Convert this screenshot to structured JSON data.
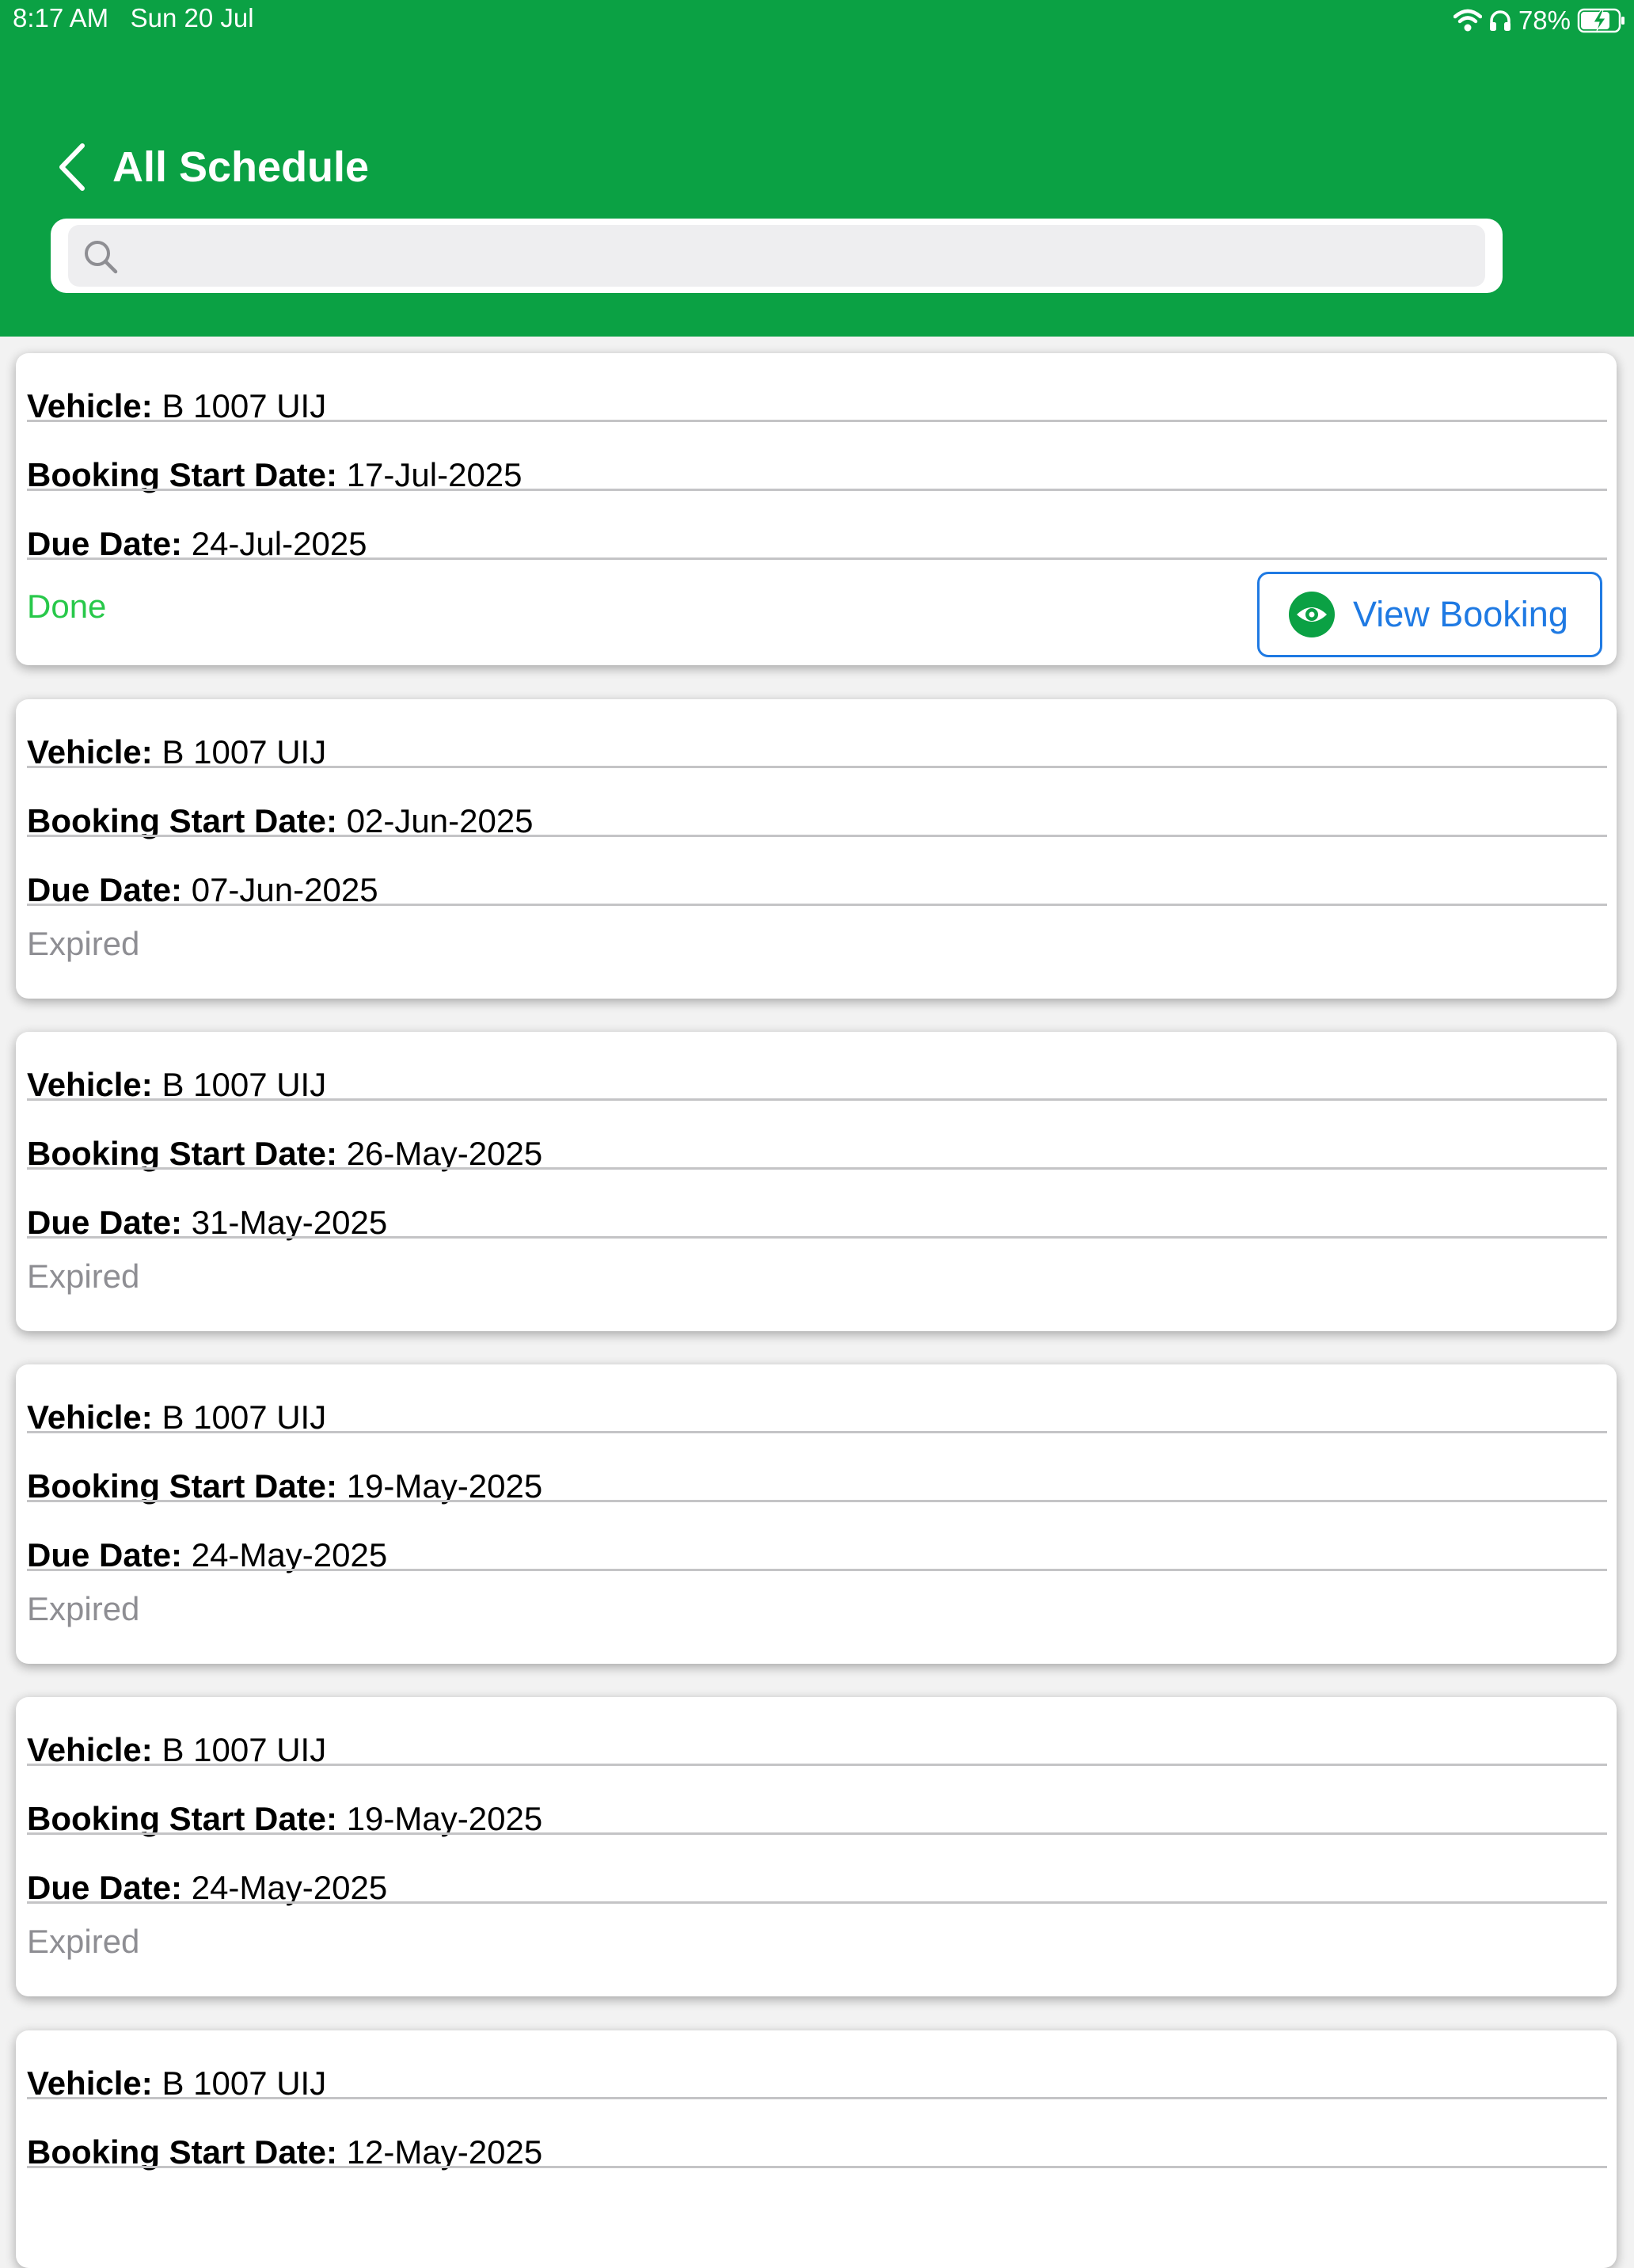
{
  "status_bar": {
    "time": "8:17 AM",
    "date": "Sun 20 Jul",
    "battery_percent": "78%",
    "icons": [
      "wifi-icon",
      "headphones-icon",
      "battery-charging-icon"
    ]
  },
  "nav": {
    "back_icon": "chevron-left-icon",
    "title": "All Schedule"
  },
  "search": {
    "value": "",
    "placeholder": "",
    "icon": "search-icon"
  },
  "labels": {
    "vehicle": "Vehicle:",
    "booking_start": "Booking Start Date:",
    "due": "Due Date:"
  },
  "bookings": [
    {
      "vehicle": "B 1007 UIJ",
      "start": "17-Jul-2025",
      "due": "24-Jul-2025",
      "status": "Done",
      "action": "View Booking"
    },
    {
      "vehicle": "B 1007 UIJ",
      "start": "02-Jun-2025",
      "due": "07-Jun-2025",
      "status": "Expired"
    },
    {
      "vehicle": "B 1007 UIJ",
      "start": "26-May-2025",
      "due": "31-May-2025",
      "status": "Expired"
    },
    {
      "vehicle": "B 1007 UIJ",
      "start": "19-May-2025",
      "due": "24-May-2025",
      "status": "Expired"
    },
    {
      "vehicle": "B 1007 UIJ",
      "start": "19-May-2025",
      "due": "24-May-2025",
      "status": "Expired"
    },
    {
      "vehicle": "B 1007 UIJ",
      "start": "12-May-2025"
    }
  ],
  "colors": {
    "header_green": "#0ba144",
    "done_green": "#28c84a",
    "expired_gray": "#8e8e93",
    "link_blue": "#1f7ae3",
    "eye_green": "#0ba144"
  }
}
